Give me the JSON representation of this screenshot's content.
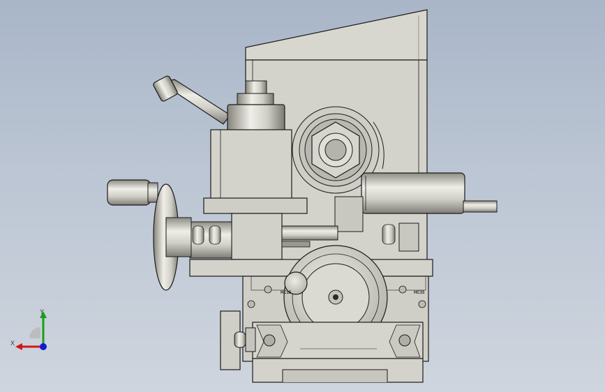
{
  "model": {
    "label_left": "HC15",
    "label_right": "HC15"
  },
  "triad": {
    "x_label": "X",
    "y_label": "Y"
  },
  "colors": {
    "background_top": "#a9b6c8",
    "background_bottom": "#cfd5de",
    "metal": "#d4d3cb",
    "edge": "#1a1a1a",
    "axis_x": "#d01818",
    "axis_y": "#18a018",
    "axis_z": "#1818d0"
  }
}
